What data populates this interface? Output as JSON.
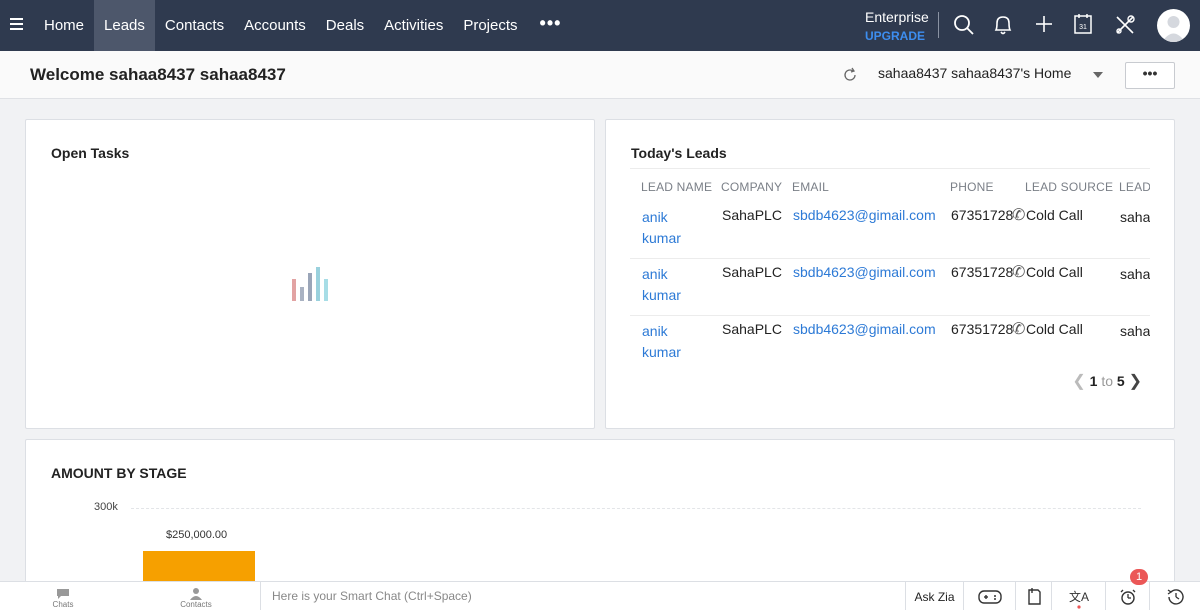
{
  "nav": {
    "items": [
      {
        "label": "Home",
        "active": false
      },
      {
        "label": "Leads",
        "active": true
      },
      {
        "label": "Contacts",
        "active": false
      },
      {
        "label": "Accounts",
        "active": false
      },
      {
        "label": "Deals",
        "active": false
      },
      {
        "label": "Activities",
        "active": false
      },
      {
        "label": "Projects",
        "active": false
      }
    ],
    "more_label": "•••",
    "edition": "Enterprise",
    "upgrade": "UPGRADE",
    "icons": [
      "search-icon",
      "bell-icon",
      "plus-icon",
      "calendar-icon",
      "tools-icon",
      "avatar"
    ]
  },
  "header": {
    "welcome": "Welcome sahaa8437 sahaa8437",
    "home_selector": "sahaa8437 sahaa8437's Home",
    "more_label": "•••"
  },
  "open_tasks": {
    "title": "Open Tasks"
  },
  "todays_leads": {
    "title": "Today's Leads",
    "columns": [
      "LEAD NAME",
      "COMPANY",
      "EMAIL",
      "PHONE",
      "LEAD SOURCE",
      "LEAD"
    ],
    "rows": [
      {
        "name": "anik kumar",
        "company": "SahaPLC",
        "email": "sbdb4623@gimail.com",
        "phone": "67351728",
        "source": "Cold Call",
        "owner": "saha"
      },
      {
        "name": "anik kumar",
        "company": "SahaPLC",
        "email": "sbdb4623@gimail.com",
        "phone": "67351728",
        "source": "Cold Call",
        "owner": "saha"
      },
      {
        "name": "anik kumar",
        "company": "SahaPLC",
        "email": "sbdb4623@gimail.com",
        "phone": "67351728",
        "source": "Cold Call",
        "owner": "saha"
      }
    ],
    "pager": {
      "from": "1",
      "to_word": "to",
      "to": "5"
    }
  },
  "amount_by_stage": {
    "title": "AMOUNT BY STAGE",
    "y_tick": "300k",
    "bar_label": "$250,000.00",
    "bar_color": "#f6a000"
  },
  "footer": {
    "chats": "Chats",
    "contacts": "Contacts",
    "smart_chat_placeholder": "Here is your Smart Chat (Ctrl+Space)",
    "ask_zia": "Ask Zia",
    "notification_count": "1"
  },
  "colors": {
    "topbar": "#2f3a4f",
    "link": "#2d7ad6",
    "upgrade": "#3d8ef0",
    "badge": "#eb5757"
  }
}
